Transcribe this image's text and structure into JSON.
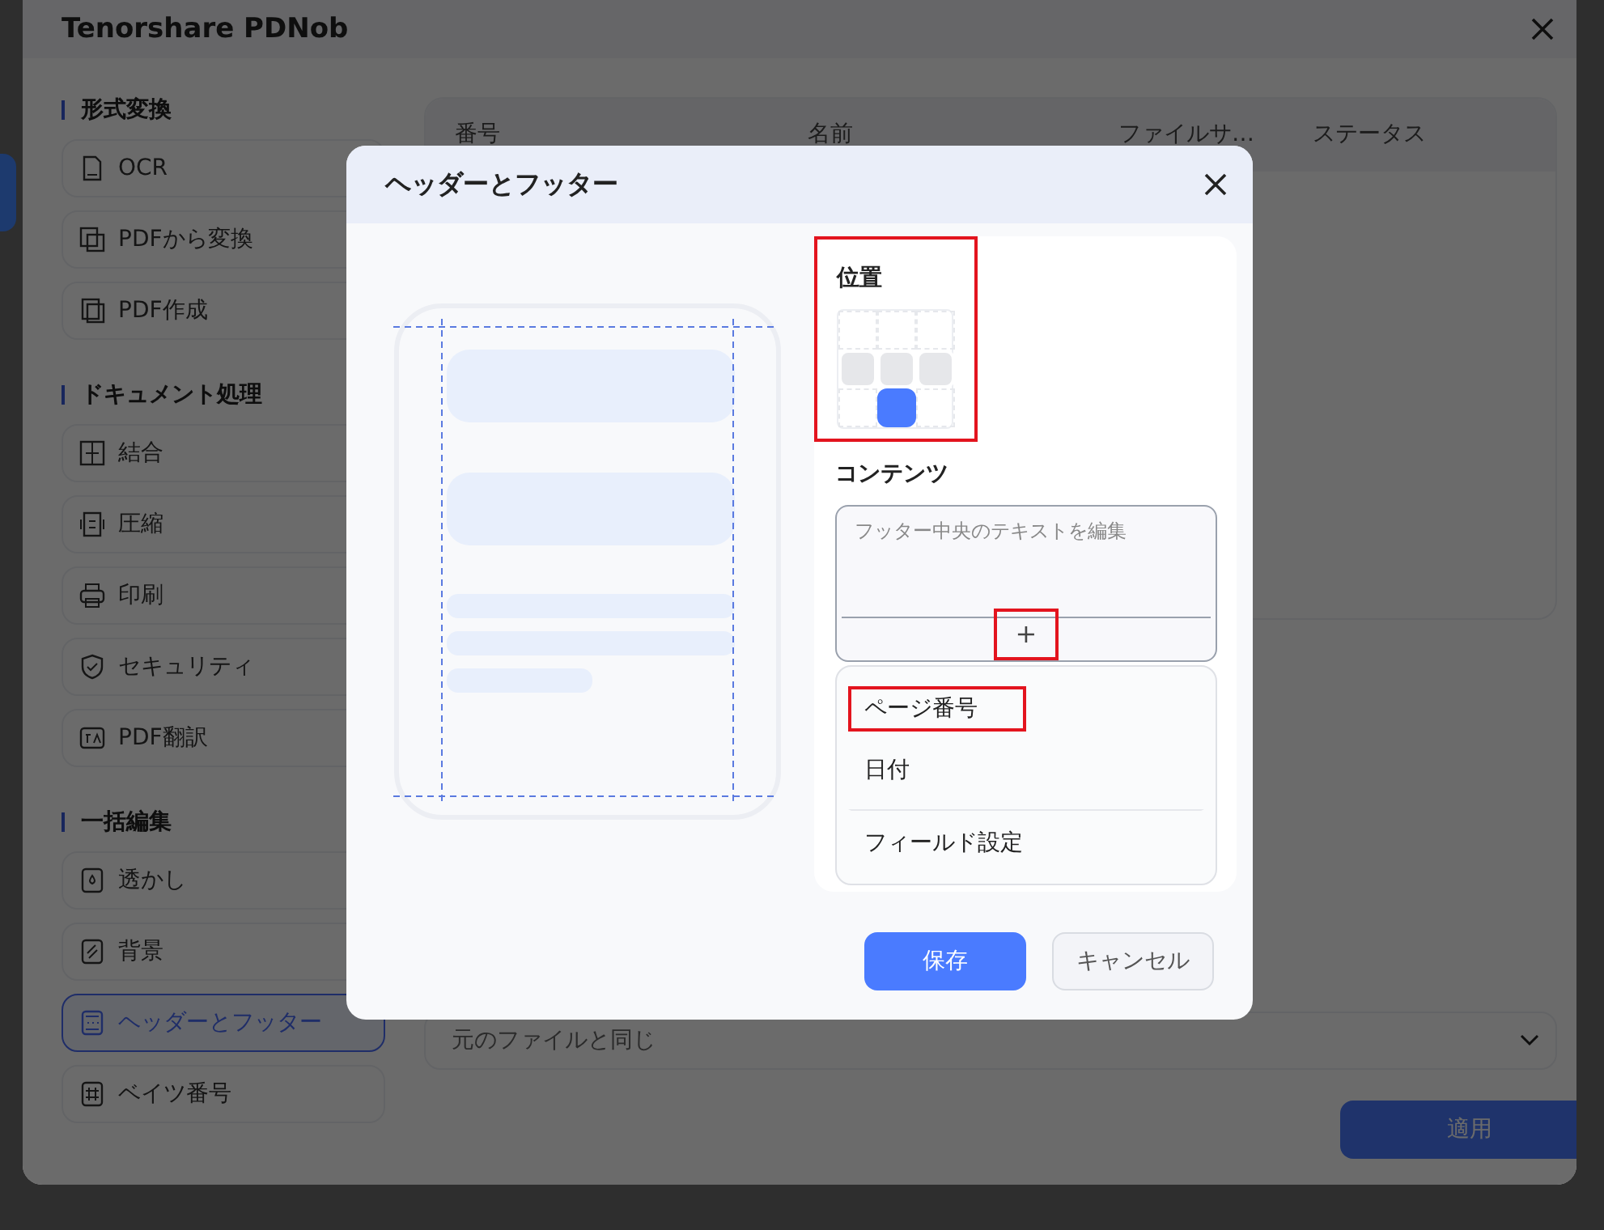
{
  "app": {
    "title": "Tenorshare PDNob"
  },
  "sidebar": {
    "groups": [
      {
        "title": "形式変換",
        "items": [
          {
            "label": "OCR",
            "selected": false
          },
          {
            "label": "PDFから変換",
            "selected": false
          },
          {
            "label": "PDF作成",
            "selected": false
          }
        ]
      },
      {
        "title": "ドキュメント処理",
        "items": [
          {
            "label": "結合",
            "selected": false
          },
          {
            "label": "圧縮",
            "selected": false
          },
          {
            "label": "印刷",
            "selected": false
          },
          {
            "label": "セキュリティ",
            "selected": false
          },
          {
            "label": "PDF翻訳",
            "selected": false
          }
        ]
      },
      {
        "title": "一括編集",
        "items": [
          {
            "label": "透かし",
            "selected": false
          },
          {
            "label": "背景",
            "selected": false
          },
          {
            "label": "ヘッダーとフッター",
            "selected": true
          },
          {
            "label": "ベイツ番号",
            "selected": false
          }
        ]
      }
    ]
  },
  "table": {
    "columns": [
      "番号",
      "名前",
      "ファイルサ…",
      "ステータス"
    ]
  },
  "output_select": {
    "value": "元のファイルと同じ"
  },
  "apply_button": {
    "label": "適用"
  },
  "dialog": {
    "title": "ヘッダーとフッター",
    "position": {
      "label": "位置",
      "highlighted": true,
      "cells": [
        {
          "available": false,
          "selected": false
        },
        {
          "available": false,
          "selected": false
        },
        {
          "available": false,
          "selected": false
        },
        {
          "available": true,
          "selected": false
        },
        {
          "available": true,
          "selected": false
        },
        {
          "available": true,
          "selected": false
        },
        {
          "available": false,
          "selected": false
        },
        {
          "available": true,
          "selected": true
        },
        {
          "available": false,
          "selected": false
        }
      ]
    },
    "content": {
      "label": "コンテンツ",
      "placeholder": "フッター中央のテキストを編集",
      "add_button": {
        "label": "+",
        "highlighted": true
      }
    },
    "menu": [
      {
        "label": "ページ番号",
        "highlighted": true,
        "separated": false
      },
      {
        "label": "日付",
        "highlighted": false,
        "separated": false
      },
      {
        "label": "フィールド設定",
        "highlighted": false,
        "separated": true
      }
    ],
    "buttons": [
      {
        "label": "保存",
        "kind": "primary"
      },
      {
        "label": "キャンセル",
        "kind": "secondary"
      }
    ]
  }
}
